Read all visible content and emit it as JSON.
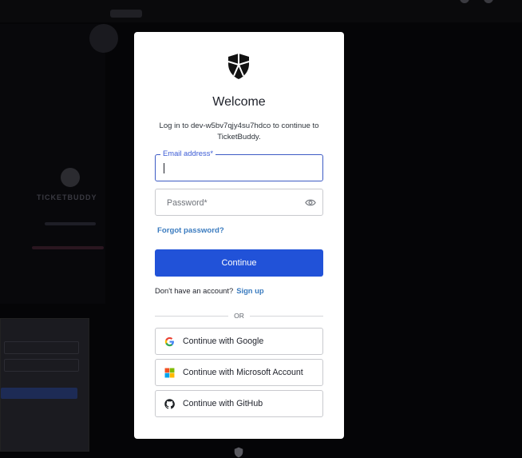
{
  "background_app": {
    "brand": "TICKETBUDDY"
  },
  "dialog": {
    "title": "Welcome",
    "subtitle": "Log in to dev-w5bv7qjy4su7hdco to continue to TicketBuddy.",
    "email_label": "Email address*",
    "email_value": "",
    "password_placeholder": "Password*",
    "forgot_password": "Forgot password?",
    "continue_label": "Continue",
    "no_account_text": "Don't have an account?",
    "signup_label": "Sign up",
    "divider_text": "OR",
    "social_buttons": [
      {
        "label": "Continue with Google",
        "icon": "google-icon"
      },
      {
        "label": "Continue with Microsoft Account",
        "icon": "microsoft-icon"
      },
      {
        "label": "Continue with GitHub",
        "icon": "github-icon"
      }
    ]
  },
  "colors": {
    "primary_button": "#2152d8",
    "focus_border": "#3d5bc4",
    "link": "#3a7bbf",
    "overlay": "#000000"
  }
}
